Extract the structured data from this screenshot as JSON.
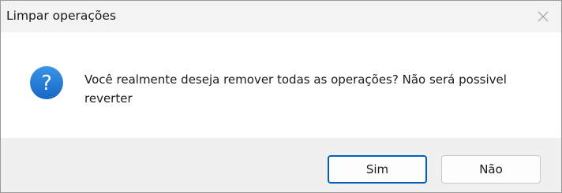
{
  "dialog": {
    "title": "Limpar operações",
    "close_icon": "close-icon",
    "question_icon": "question-icon",
    "message": "Você realmente deseja remover todas as operações? Não será possivel reverter",
    "buttons": {
      "yes_label": "Sim",
      "no_label": "Não"
    },
    "colors": {
      "accent": "#005fb8",
      "icon_blue": "#1c7ad6",
      "titlebar_bg": "#f3f3f3",
      "footer_bg": "#f0f0f0"
    }
  }
}
